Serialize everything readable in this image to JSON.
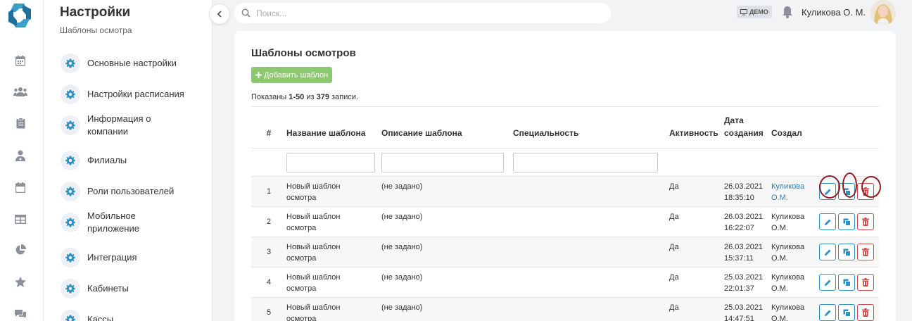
{
  "topbar": {
    "search_placeholder": "Поиск...",
    "demo_label": "ДЕМО",
    "user_name": "Куликова О. М."
  },
  "sidebar": {
    "title": "Настройки",
    "subtitle": "Шаблоны осмотра",
    "items": [
      {
        "label": "Основные настройки"
      },
      {
        "label": "Настройки расписания"
      },
      {
        "label": "Информация о компании"
      },
      {
        "label": "Филиалы"
      },
      {
        "label": "Роли пользователей"
      },
      {
        "label": "Мобильное приложение"
      },
      {
        "label": "Интеграция"
      },
      {
        "label": "Кабинеты"
      },
      {
        "label": "Кассы"
      }
    ]
  },
  "rail_icons": [
    "calendar-icon",
    "users-icon",
    "clipboard-icon",
    "doctor-icon",
    "schedule-icon",
    "table-icon",
    "pie-chart-icon",
    "star-icon",
    "chat-icon"
  ],
  "main": {
    "title": "Шаблоны осмотров",
    "add_button": "Добавить шаблон",
    "summary_prefix": "Показаны ",
    "summary_range": "1-50",
    "summary_mid": " из ",
    "summary_total": "379",
    "summary_suffix": " записи.",
    "columns": {
      "num": "#",
      "name": "Название шаблона",
      "description": "Описание шаблона",
      "specialty": "Специальность",
      "active": "Активность",
      "created": "Дата создания",
      "author": "Создал"
    },
    "rows": [
      {
        "num": "1",
        "name": "Новый шаблон осмотра",
        "description": "(не задано)",
        "specialty": "",
        "active": "Да",
        "date": "26.03.2021",
        "time": "18:35:10",
        "author": "Куликова О.М.",
        "author_link": true
      },
      {
        "num": "2",
        "name": "Новый шаблон осмотра",
        "description": "(не задано)",
        "specialty": "",
        "active": "Да",
        "date": "26.03.2021",
        "time": "16:22:07",
        "author": "Куликова О.М.",
        "author_link": false
      },
      {
        "num": "3",
        "name": "Новый шаблон осмотра",
        "description": "(не задано)",
        "specialty": "",
        "active": "Да",
        "date": "26.03.2021",
        "time": "15:37:11",
        "author": "Куликова О.М.",
        "author_link": false
      },
      {
        "num": "4",
        "name": "Новый шаблон осмотра",
        "description": "(не задано)",
        "specialty": "",
        "active": "Да",
        "date": "25.03.2021",
        "time": "22:01:37",
        "author": "Куликова О.М.",
        "author_link": false
      },
      {
        "num": "5",
        "name": "Новый шаблон осмотра",
        "description": "(не задано)",
        "specialty": "",
        "active": "Да",
        "date": "25.03.2021",
        "time": "14:47:51",
        "author": "Куликова О.М.",
        "author_link": false
      }
    ]
  },
  "colors": {
    "accent": "#2f90c2",
    "add_button": "#8cc870",
    "danger": "#d24b4b",
    "link": "#2f7fb7",
    "annotation_ring": "#8b1f24"
  }
}
